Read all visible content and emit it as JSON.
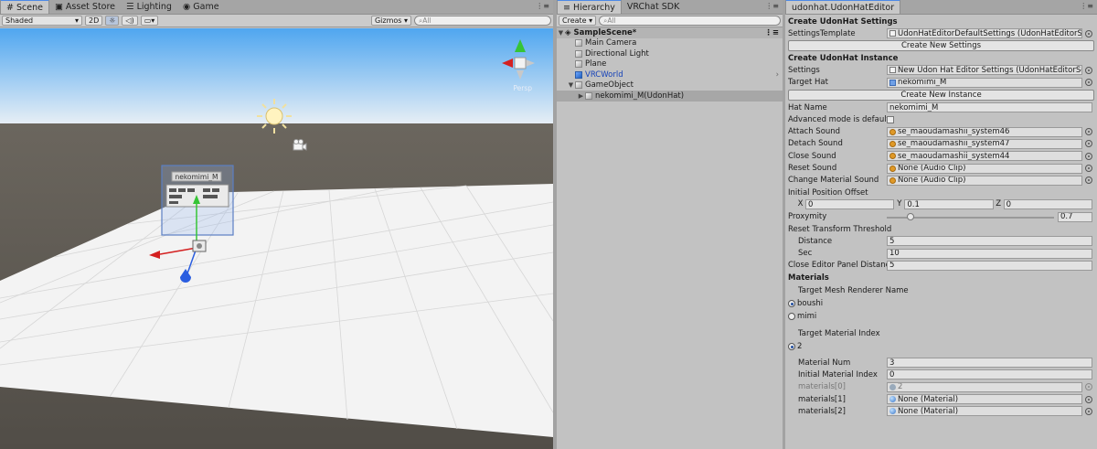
{
  "scene_tabs": [
    {
      "label": "Scene",
      "icon": "scene-grid-icon"
    },
    {
      "label": "Asset Store",
      "icon": "store-icon"
    },
    {
      "label": "Lighting",
      "icon": "lighting-icon"
    },
    {
      "label": "Game",
      "icon": "game-icon"
    }
  ],
  "scene_toolbar": {
    "shading_mode": "Shaded",
    "mode_2d": "2D",
    "gizmos": "Gizmos",
    "search_placeholder": "All"
  },
  "scene_view": {
    "projection_label": "Persp",
    "object_label": "nekomimi_M"
  },
  "hierarchy_tabs": [
    {
      "label": "Hierarchy"
    },
    {
      "label": "VRChat SDK"
    }
  ],
  "hierarchy_toolbar": {
    "create_label": "Create",
    "search_placeholder": "All"
  },
  "hierarchy": {
    "scene_name": "SampleScene*",
    "items": [
      {
        "label": "Main Camera",
        "depth": 1
      },
      {
        "label": "Directional Light",
        "depth": 1
      },
      {
        "label": "Plane",
        "depth": 1
      },
      {
        "label": "VRCWorld",
        "depth": 1
      },
      {
        "label": "GameObject",
        "depth": 1
      },
      {
        "label": "nekomimi_M(UdonHat)",
        "depth": 2
      }
    ]
  },
  "inspector": {
    "tab_label": "udonhat.UdonHatEditor",
    "section_settings_title": "Create UdonHat Settings",
    "settings_template_label": "SettingsTemplate",
    "settings_template_value": "UdonHatEditorDefaultSettings (UdonHatEditorSe",
    "create_new_settings_label": "Create New Settings",
    "section_instance_title": "Create UdonHat Instance",
    "settings_label": "Settings",
    "settings_value": "New Udon Hat Editor Settings (UdonHatEditorSe",
    "target_hat_label": "Target Hat",
    "target_hat_value": "nekomimi_M",
    "create_new_instance_label": "Create New Instance",
    "hat_name_label": "Hat Name",
    "hat_name_value": "nekomimi_M",
    "advanced_mode_label": "Advanced mode is default",
    "sounds": [
      {
        "label": "Attach Sound",
        "value": "se_maoudamashii_system46"
      },
      {
        "label": "Detach Sound",
        "value": "se_maoudamashii_system47"
      },
      {
        "label": "Close Sound",
        "value": "se_maoudamashii_system44"
      },
      {
        "label": "Reset Sound",
        "value": "None (Audio Clip)"
      },
      {
        "label": "Change Material Sound",
        "value": "None (Audio Clip)"
      }
    ],
    "initial_position_label": "Initial Position Offset",
    "x_label": "X",
    "x_value": "0",
    "y_label": "Y",
    "y_value": "0.1",
    "z_label": "Z",
    "z_value": "0",
    "proxymity_label": "Proxymity",
    "proxymity_value": "0.7",
    "proxymity_fraction": 0.14,
    "reset_threshold_label": "Reset Transform Threshold",
    "distance_label": "Distance",
    "distance_value": "5",
    "sec_label": "Sec",
    "sec_value": "10",
    "close_distance_label": "Close Editor Panel Distance",
    "close_distance_value": "5",
    "materials_title": "Materials",
    "target_mesh_label": "Target Mesh Renderer Name",
    "mesh_options": [
      {
        "label": "boushi",
        "selected": true
      },
      {
        "label": "mimi",
        "selected": false
      }
    ],
    "target_material_index_label": "Target Material Index",
    "material_index_options": [
      {
        "label": "2",
        "selected": true
      }
    ],
    "material_num_label": "Material Num",
    "material_num_value": "3",
    "initial_material_index_label": "Initial Material Index",
    "initial_material_index_value": "0",
    "materials_list": [
      {
        "label": "materials[0]",
        "value": "2",
        "disabled": true
      },
      {
        "label": "materials[1]",
        "value": "None (Material)",
        "disabled": false
      },
      {
        "label": "materials[2]",
        "value": "None (Material)",
        "disabled": false
      }
    ]
  },
  "colors": {
    "tab_accent": "#4d8ae6",
    "sky_top": "#4fa6f0",
    "ground": "#5b5750",
    "plane": "#f2f2f2",
    "prefab_blue": "#1642b8"
  }
}
